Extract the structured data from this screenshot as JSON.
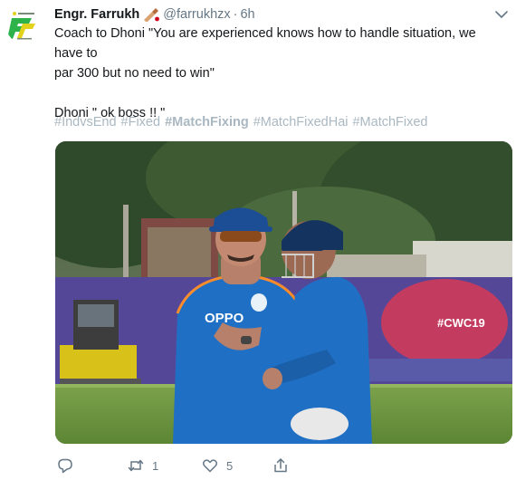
{
  "tweet": {
    "author": {
      "name": "Engr. Farrukh",
      "handle": "@farrukhzx",
      "emoji": "cricket-bat-icon"
    },
    "separator": "·",
    "time": "6h",
    "lines": [
      "Coach to Dhoni \"You are experienced knows how to handle situation, we have to",
      "par 300 but no need to win\"",
      "Dhoni \" ok boss !! \""
    ],
    "hashtags": [
      "#IndvsEnd",
      "#Fixed",
      "#MatchFixing",
      "#MatchFixedHai",
      "#MatchFixed"
    ],
    "media": {
      "jersey_text": "OPPO",
      "board_text": "#CWC19"
    },
    "actions": {
      "reply_count": "",
      "retweet_count": "1",
      "like_count": "5"
    }
  },
  "colors": {
    "text": "#14171a",
    "secondary": "#657786",
    "hashtag": "#aab8c2",
    "jersey": "#1f6fc4",
    "avatar_green": "#2db34a",
    "avatar_yellow": "#e3d21c"
  }
}
